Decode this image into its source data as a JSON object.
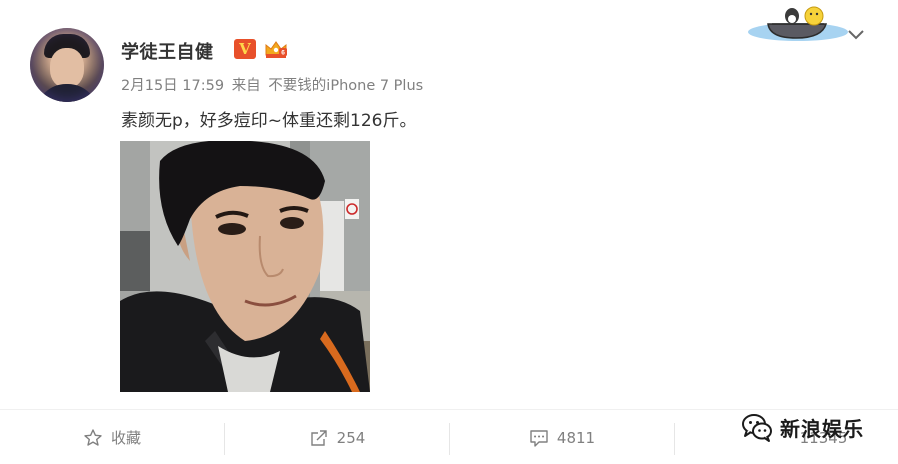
{
  "post": {
    "username": "学徒王自健",
    "verified_badge": "V",
    "timestamp": "2月15日 17:59",
    "source_prefix": "来自",
    "source": "不要钱的iPhone 7 Plus",
    "text": "素颜无p，好多痘印~体重还剩126斤。"
  },
  "actions": {
    "favorite_label": "收藏",
    "repost_count": "254",
    "comment_count": "4811",
    "like_count": "11345"
  },
  "watermark": {
    "text": "新浪娱乐"
  },
  "colors": {
    "verified_bg": "#e8502a",
    "verified_fg": "#ffd64a",
    "text_primary": "#333333",
    "text_secondary": "#808080",
    "divider": "#e6e6e6"
  },
  "icons": {
    "favorite": "star-outline-icon",
    "repost": "share-arrow-icon",
    "comment": "comment-bubble-icon",
    "more": "chevron-down-icon",
    "watermark": "wechat-bubble-icon"
  }
}
